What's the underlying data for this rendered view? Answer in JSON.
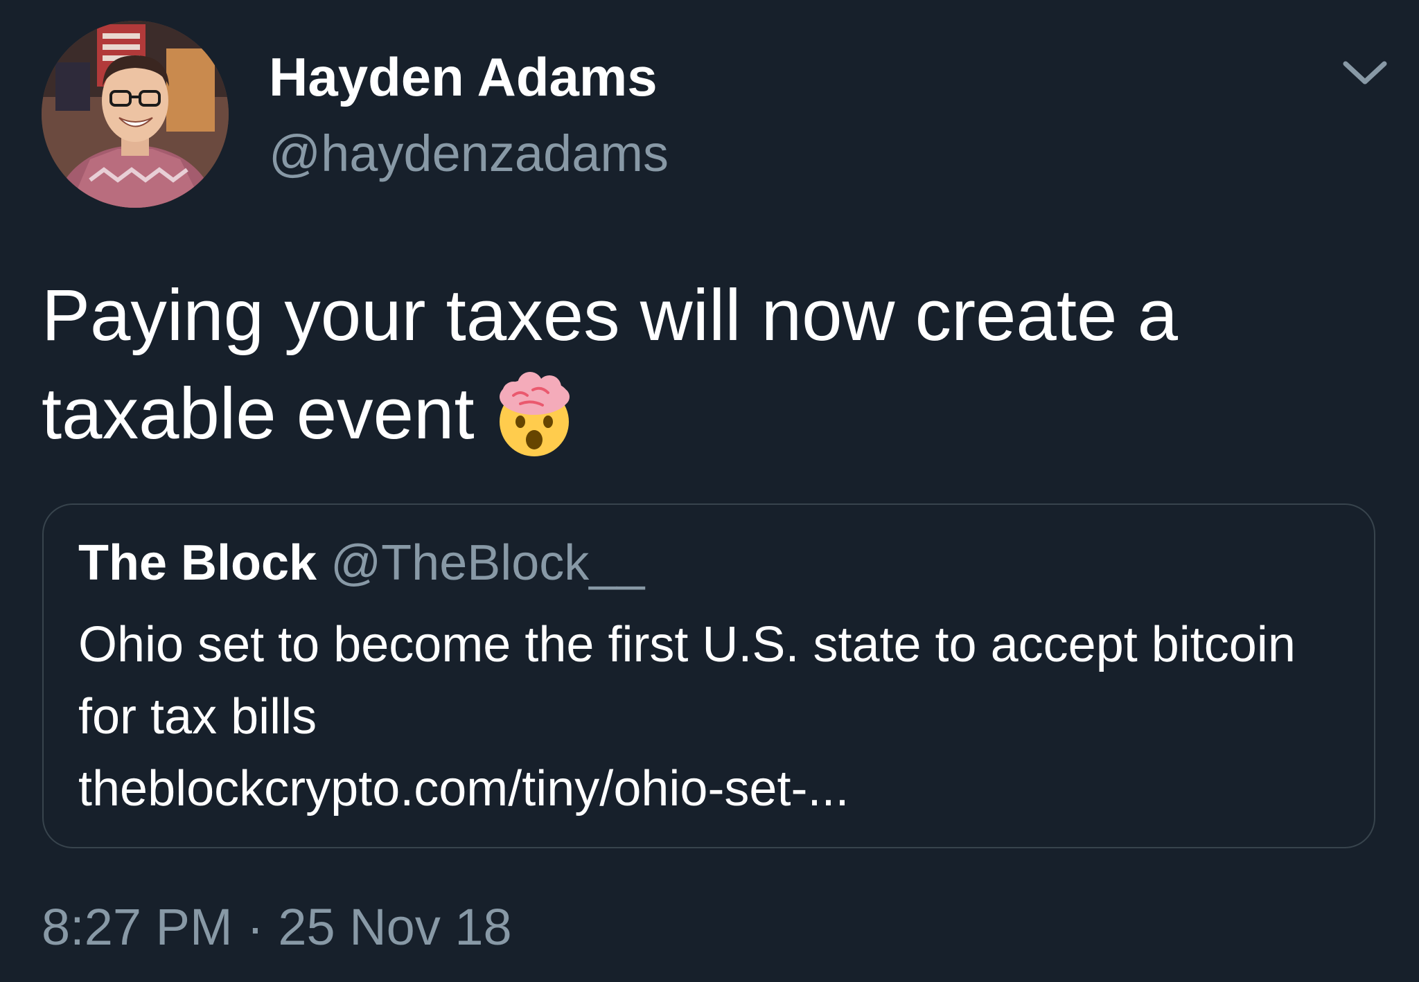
{
  "tweet": {
    "author": {
      "name": "Hayden Adams",
      "handle": "@haydenzadams"
    },
    "text": "Paying your taxes will now create a taxable event",
    "emoji_icon": "exploding-head-emoji",
    "quoted_tweet": {
      "author_name": "The Block",
      "author_handle": "@TheBlock__",
      "text": "Ohio set to become the first U.S. state to accept bitcoin for tax bills",
      "link": "theblockcrypto.com/tiny/ohio-set-..."
    },
    "timestamp": {
      "time": "8:27 PM",
      "separator": "·",
      "date": "25 Nov 18"
    }
  },
  "colors": {
    "background": "#17202b",
    "primary_text": "#ffffff",
    "secondary_text": "#8899a6",
    "border": "#38444d"
  },
  "icons": {
    "menu": "chevron-down-icon"
  }
}
